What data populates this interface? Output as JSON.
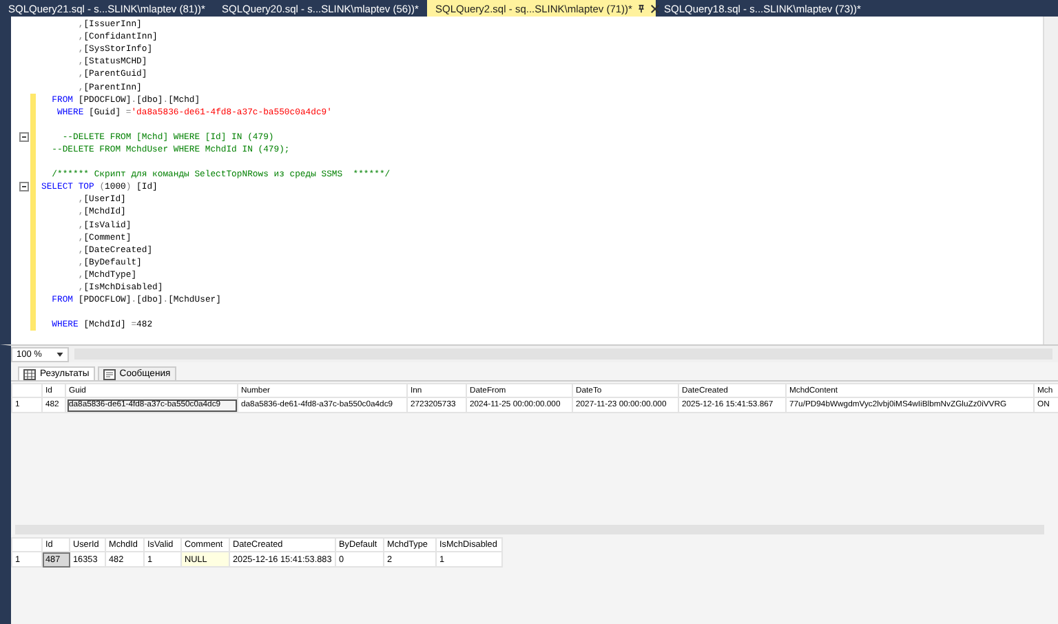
{
  "tabs": [
    {
      "label": "SQLQuery21.sql - s...SLINK\\mlaptev (81))*",
      "selected": false
    },
    {
      "label": "SQLQuery20.sql - s...SLINK\\mlaptev (56))*",
      "selected": false
    },
    {
      "label": "SQLQuery2.sql - sq...SLINK\\mlaptev (71))*",
      "selected": true
    },
    {
      "label": "SQLQuery18.sql - s...SLINK\\mlaptev (73))*",
      "selected": false
    }
  ],
  "editor": {
    "lines": [
      {
        "modified": false,
        "collapsible": false,
        "segments": [
          {
            "kind": "op",
            "text": "       ,"
          },
          {
            "kind": "text",
            "text": "[IssuerInn]"
          }
        ]
      },
      {
        "modified": false,
        "collapsible": false,
        "segments": [
          {
            "kind": "op",
            "text": "       ,"
          },
          {
            "kind": "text",
            "text": "[ConfidantInn]"
          }
        ]
      },
      {
        "modified": false,
        "collapsible": false,
        "segments": [
          {
            "kind": "op",
            "text": "       ,"
          },
          {
            "kind": "text",
            "text": "[SysStorInfo]"
          }
        ]
      },
      {
        "modified": false,
        "collapsible": false,
        "segments": [
          {
            "kind": "op",
            "text": "       ,"
          },
          {
            "kind": "text",
            "text": "[StatusMCHD]"
          }
        ]
      },
      {
        "modified": false,
        "collapsible": false,
        "segments": [
          {
            "kind": "op",
            "text": "       ,"
          },
          {
            "kind": "text",
            "text": "[ParentGuid]"
          }
        ]
      },
      {
        "modified": false,
        "collapsible": false,
        "segments": [
          {
            "kind": "op",
            "text": "       ,"
          },
          {
            "kind": "text",
            "text": "[ParentInn]"
          }
        ]
      },
      {
        "modified": true,
        "collapsible": false,
        "segments": [
          {
            "kind": "keyword",
            "text": "  FROM "
          },
          {
            "kind": "text",
            "text": "[PDOCFLOW]"
          },
          {
            "kind": "op",
            "text": "."
          },
          {
            "kind": "text",
            "text": "[dbo]"
          },
          {
            "kind": "op",
            "text": "."
          },
          {
            "kind": "text",
            "text": "[Mchd]"
          }
        ]
      },
      {
        "modified": true,
        "collapsible": false,
        "segments": [
          {
            "kind": "keyword",
            "text": "   WHERE "
          },
          {
            "kind": "text",
            "text": "[Guid] "
          },
          {
            "kind": "op",
            "text": "="
          },
          {
            "kind": "string",
            "text": "'da8a5836-de61-4fd8-a37c-ba550c0a4dc9'"
          }
        ]
      },
      {
        "modified": true,
        "collapsible": false
      },
      {
        "modified": true,
        "collapsible": true,
        "segments": [
          {
            "kind": "comment",
            "text": "    --DELETE FROM [Mchd] WHERE [Id] IN (479)"
          }
        ]
      },
      {
        "modified": true,
        "collapsible": false,
        "segments": [
          {
            "kind": "comment",
            "text": "  --DELETE FROM MchdUser WHERE MchdId IN (479);"
          }
        ]
      },
      {
        "modified": true,
        "collapsible": false
      },
      {
        "modified": true,
        "collapsible": false,
        "segments": [
          {
            "kind": "comment",
            "text": "  /****** Скрипт для команды SelectTopNRows из среды SSMS  ******/"
          }
        ]
      },
      {
        "modified": true,
        "collapsible": true,
        "segments": [
          {
            "kind": "keyword",
            "text": "SELECT TOP "
          },
          {
            "kind": "op",
            "text": "("
          },
          {
            "kind": "text",
            "text": "1000"
          },
          {
            "kind": "op",
            "text": ") "
          },
          {
            "kind": "text",
            "text": "[Id]"
          }
        ]
      },
      {
        "modified": true,
        "collapsible": false,
        "segments": [
          {
            "kind": "op",
            "text": "       ,"
          },
          {
            "kind": "text",
            "text": "[UserId]"
          }
        ]
      },
      {
        "modified": true,
        "collapsible": false,
        "segments": [
          {
            "kind": "op",
            "text": "       ,"
          },
          {
            "kind": "text",
            "text": "[MchdId]"
          }
        ]
      },
      {
        "modified": true,
        "collapsible": false,
        "segments": [
          {
            "kind": "op",
            "text": "       ,"
          },
          {
            "kind": "text",
            "text": "[IsValid]"
          }
        ]
      },
      {
        "modified": true,
        "collapsible": false,
        "segments": [
          {
            "kind": "op",
            "text": "       ,"
          },
          {
            "kind": "text",
            "text": "[Comment]"
          }
        ]
      },
      {
        "modified": true,
        "collapsible": false,
        "segments": [
          {
            "kind": "op",
            "text": "       ,"
          },
          {
            "kind": "text",
            "text": "[DateCreated]"
          }
        ]
      },
      {
        "modified": true,
        "collapsible": false,
        "segments": [
          {
            "kind": "op",
            "text": "       ,"
          },
          {
            "kind": "text",
            "text": "[ByDefault]"
          }
        ]
      },
      {
        "modified": true,
        "collapsible": false,
        "segments": [
          {
            "kind": "op",
            "text": "       ,"
          },
          {
            "kind": "text",
            "text": "[MchdType]"
          }
        ]
      },
      {
        "modified": true,
        "collapsible": false,
        "segments": [
          {
            "kind": "op",
            "text": "       ,"
          },
          {
            "kind": "text",
            "text": "[IsMchDisabled]"
          }
        ]
      },
      {
        "modified": true,
        "collapsible": false,
        "segments": [
          {
            "kind": "keyword",
            "text": "  FROM "
          },
          {
            "kind": "text",
            "text": "[PDOCFLOW]"
          },
          {
            "kind": "op",
            "text": "."
          },
          {
            "kind": "text",
            "text": "[dbo]"
          },
          {
            "kind": "op",
            "text": "."
          },
          {
            "kind": "text",
            "text": "[MchdUser]"
          }
        ]
      },
      {
        "modified": true,
        "collapsible": false
      },
      {
        "modified": true,
        "collapsible": false,
        "segments": [
          {
            "kind": "keyword",
            "text": "  WHERE "
          },
          {
            "kind": "text",
            "text": "[MchdId] "
          },
          {
            "kind": "op",
            "text": "="
          },
          {
            "kind": "text",
            "text": "482"
          }
        ]
      }
    ]
  },
  "zoom": {
    "value": "100 %"
  },
  "result_tabs": [
    {
      "label": "Результаты",
      "selected": true,
      "kind": "grid"
    },
    {
      "label": "Сообщения",
      "selected": false,
      "kind": "messages"
    }
  ],
  "grids": [
    {
      "columns": [
        "Id",
        "Guid",
        "Number",
        "Inn",
        "DateFrom",
        "DateTo",
        "DateCreated",
        "MchdContent",
        "Mch"
      ],
      "rows": [
        {
          "number": "1",
          "cells": [
            {
              "text": "482",
              "focused": false,
              "kind": "value"
            },
            {
              "text": "da8a5836-de61-4fd8-a37c-ba550c0a4dc9",
              "focused": true,
              "kind": "value"
            },
            {
              "text": "da8a5836-de61-4fd8-a37c-ba550c0a4dc9",
              "focused": false,
              "kind": "value"
            },
            {
              "text": "2723205733",
              "focused": false,
              "kind": "value"
            },
            {
              "text": "2024-11-25 00:00:00.000",
              "focused": false,
              "kind": "value"
            },
            {
              "text": "2027-11-23 00:00:00.000",
              "focused": false,
              "kind": "value"
            },
            {
              "text": "2025-12-16 15:41:53.867",
              "focused": false,
              "kind": "value"
            },
            {
              "text": "77u/PD94bWwgdmVyc2lvbj0iMS4wIiBlbmNvZGluZz0iVVRG",
              "focused": false,
              "kind": "value"
            },
            {
              "text": "ON",
              "focused": false,
              "kind": "value"
            }
          ]
        }
      ]
    },
    {
      "columns": [
        "Id",
        "UserId",
        "MchdId",
        "IsValid",
        "Comment",
        "DateCreated",
        "ByDefault",
        "MchdType",
        "IsMchDisabled"
      ],
      "rows": [
        {
          "number": "1",
          "cells": [
            {
              "text": "487",
              "focused": true,
              "kind": "value"
            },
            {
              "text": "16353",
              "focused": false,
              "kind": "value"
            },
            {
              "text": "482",
              "focused": false,
              "kind": "value"
            },
            {
              "text": "1",
              "focused": false,
              "kind": "value"
            },
            {
              "text": "NULL",
              "focused": false,
              "kind": "null"
            },
            {
              "text": "2025-12-16 15:41:53.883",
              "focused": false,
              "kind": "value"
            },
            {
              "text": "0",
              "focused": false,
              "kind": "value"
            },
            {
              "text": "2",
              "focused": false,
              "kind": "value"
            },
            {
              "text": "1",
              "focused": false,
              "kind": "value"
            }
          ]
        }
      ]
    }
  ]
}
